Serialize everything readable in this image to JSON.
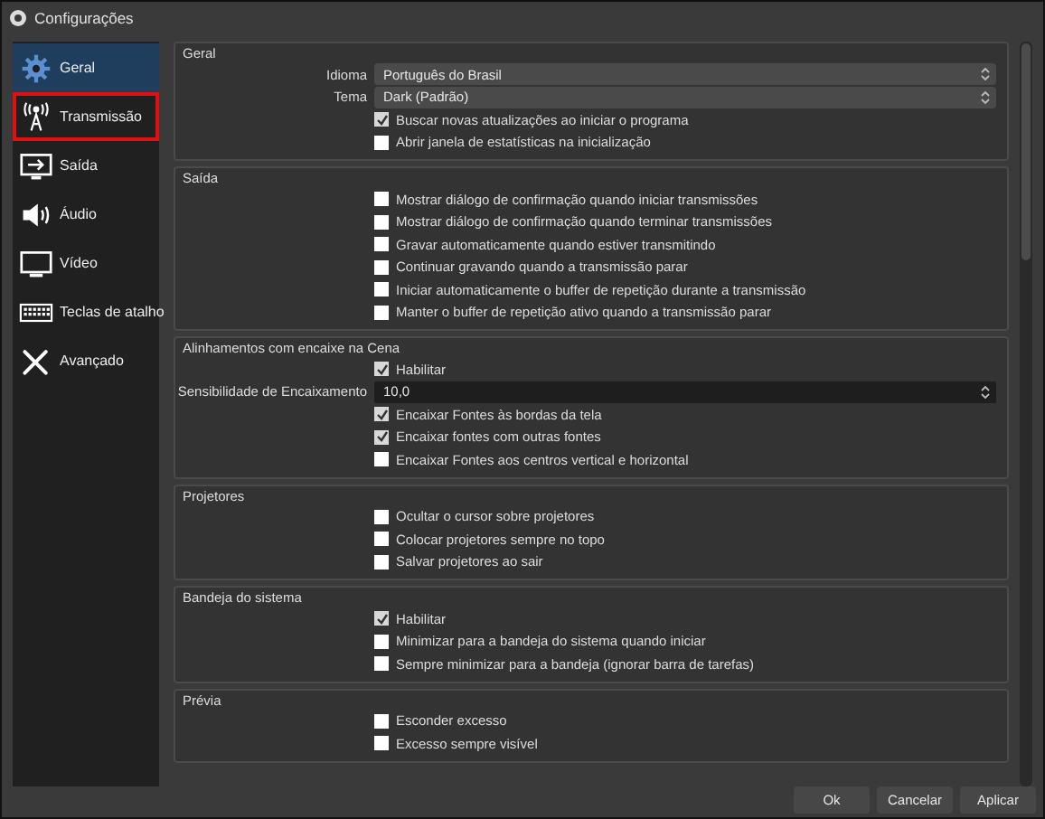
{
  "window": {
    "title": "Configurações"
  },
  "sidebar": {
    "items": [
      {
        "label": "Geral",
        "selected": true,
        "highlighted": false
      },
      {
        "label": "Transmissão",
        "selected": false,
        "highlighted": true
      },
      {
        "label": "Saída",
        "selected": false,
        "highlighted": false
      },
      {
        "label": "Áudio",
        "selected": false,
        "highlighted": false
      },
      {
        "label": "Vídeo",
        "selected": false,
        "highlighted": false
      },
      {
        "label": "Teclas de atalho",
        "selected": false,
        "highlighted": false
      },
      {
        "label": "Avançado",
        "selected": false,
        "highlighted": false
      }
    ]
  },
  "sections": [
    {
      "title": "Geral",
      "rows": [
        {
          "kind": "select",
          "label": "Idioma",
          "value": "Português do Brasil"
        },
        {
          "kind": "select",
          "label": "Tema",
          "value": "Dark (Padrão)"
        },
        {
          "kind": "checkbox",
          "label": "Buscar novas atualizações ao iniciar o programa",
          "checked": true
        },
        {
          "kind": "checkbox",
          "label": "Abrir janela de estatísticas na inicialização",
          "checked": false
        }
      ]
    },
    {
      "title": "Saída",
      "rows": [
        {
          "kind": "checkbox",
          "label": "Mostrar diálogo de confirmação quando iniciar transmissões",
          "checked": false
        },
        {
          "kind": "checkbox",
          "label": "Mostrar diálogo de confirmação quando terminar transmissões",
          "checked": false
        },
        {
          "kind": "checkbox",
          "label": "Gravar automaticamente quando estiver transmitindo",
          "checked": false
        },
        {
          "kind": "checkbox",
          "label": "Continuar gravando quando a transmissão parar",
          "checked": false
        },
        {
          "kind": "checkbox",
          "label": "Iniciar automaticamente o buffer de repetição durante a transmissão",
          "checked": false
        },
        {
          "kind": "checkbox",
          "label": "Manter o buffer de repetição ativo quando a transmissão parar",
          "checked": false
        }
      ]
    },
    {
      "title": "Alinhamentos com encaixe na Cena",
      "rows": [
        {
          "kind": "checkbox",
          "label": "Habilitar",
          "checked": true
        },
        {
          "kind": "spin",
          "label": "Sensibilidade de Encaixamento",
          "value": "10,0"
        },
        {
          "kind": "checkbox",
          "label": "Encaixar Fontes às bordas da tela",
          "checked": true
        },
        {
          "kind": "checkbox",
          "label": "Encaixar fontes com outras fontes",
          "checked": true
        },
        {
          "kind": "checkbox",
          "label": "Encaixar Fontes aos centros vertical e horizontal",
          "checked": false
        }
      ]
    },
    {
      "title": "Projetores",
      "rows": [
        {
          "kind": "checkbox",
          "label": "Ocultar o cursor sobre projetores",
          "checked": false
        },
        {
          "kind": "checkbox",
          "label": "Colocar projetores sempre no topo",
          "checked": false
        },
        {
          "kind": "checkbox",
          "label": "Salvar projetores ao sair",
          "checked": false
        }
      ]
    },
    {
      "title": "Bandeja do sistema",
      "rows": [
        {
          "kind": "checkbox",
          "label": "Habilitar",
          "checked": true
        },
        {
          "kind": "checkbox",
          "label": "Minimizar para a bandeja do sistema quando iniciar",
          "checked": false
        },
        {
          "kind": "checkbox",
          "label": "Sempre minimizar para a bandeja (ignorar barra de tarefas)",
          "checked": false
        }
      ]
    },
    {
      "title": "Prévia",
      "rows": [
        {
          "kind": "checkbox",
          "label": "Esconder excesso",
          "checked": false
        },
        {
          "kind": "checkbox",
          "label": "Excesso sempre visível",
          "checked": false
        }
      ]
    }
  ],
  "buttons": [
    "Ok",
    "Cancelar",
    "Aplicar"
  ]
}
